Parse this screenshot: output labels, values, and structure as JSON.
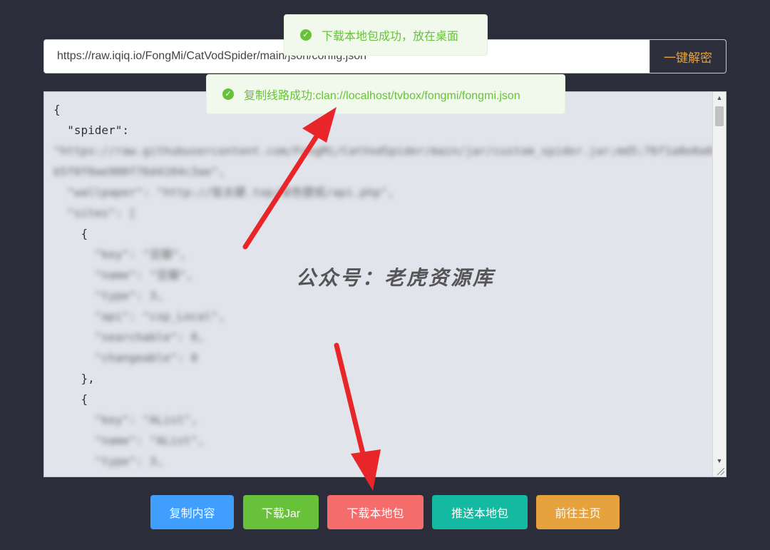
{
  "url_bar": {
    "value": "https://raw.iqiq.io/FongMi/CatVodSpider/main/json/config.json",
    "decrypt_label": "一键解密"
  },
  "editor": {
    "lines": [
      {
        "text": "{",
        "blurred": false
      },
      {
        "text": "  \"spider\":",
        "blurred": false
      },
      {
        "text": "\"https://raw.githubusercontent.com/FongMi/CatVodSpider/main/jar/custom_spider.jar;md5;76f1a8e0a01",
        "blurred": true
      },
      {
        "text": "b5f0f0ae900f76d4104c3ae\",",
        "blurred": true
      },
      {
        "text": "  \"wallpaper\": \"http://饭太硬.top/深色壁纸/api.php\",",
        "blurred": true
      },
      {
        "text": "  \"sites\": [",
        "blurred": true
      },
      {
        "text": "    {",
        "blurred": false
      },
      {
        "text": "      \"key\": \"豆瓣\",",
        "blurred": true
      },
      {
        "text": "      \"name\": \"豆瓣\",",
        "blurred": true
      },
      {
        "text": "      \"type\": 3,",
        "blurred": true
      },
      {
        "text": "      \"api\": \"csp_Local\",",
        "blurred": true
      },
      {
        "text": "      \"searchable\": 0,",
        "blurred": true
      },
      {
        "text": "      \"changeable\": 0",
        "blurred": true
      },
      {
        "text": "    },",
        "blurred": false
      },
      {
        "text": "    {",
        "blurred": false
      },
      {
        "text": "      \"key\": \"AList\",",
        "blurred": true
      },
      {
        "text": "      \"name\": \"AList\",",
        "blurred": true
      },
      {
        "text": "      \"type\": 3,",
        "blurred": true
      }
    ]
  },
  "watermark": "公众号：老虎资源库",
  "toasts": {
    "download_success": "下载本地包成功，放在桌面",
    "copy_success": "复制线路成功:clan://localhost/tvbox/fongmi/fongmi.json"
  },
  "buttons": {
    "copy_content": "复制内容",
    "download_jar": "下载Jar",
    "download_local": "下载本地包",
    "push_local": "推送本地包",
    "go_home": "前往主页"
  },
  "colors": {
    "background": "#2b2d3a",
    "success": "#67c23a",
    "primary": "#409eff",
    "danger": "#f56c6c",
    "teal": "#13b9a0",
    "warning": "#e6a23c",
    "arrow": "#e8262a"
  }
}
